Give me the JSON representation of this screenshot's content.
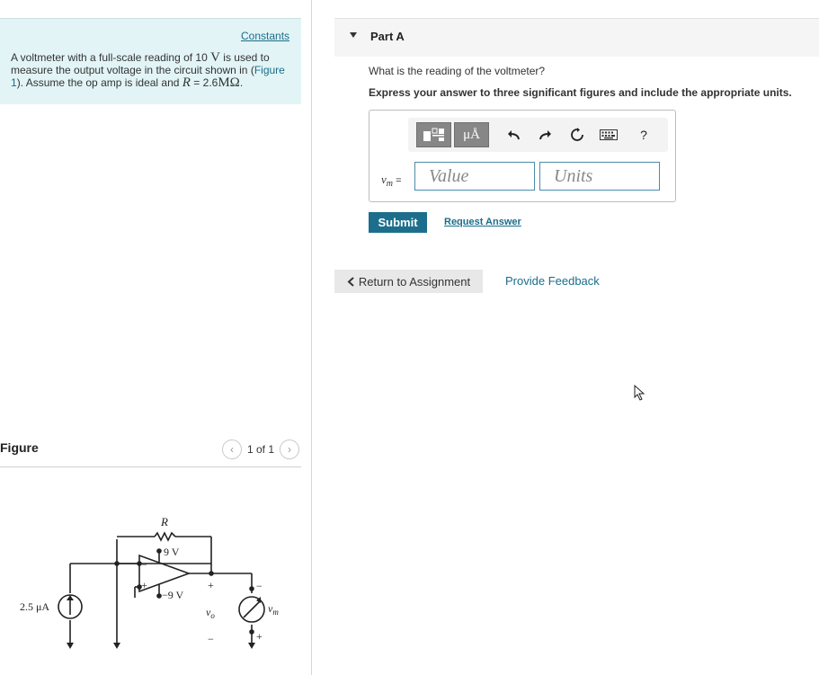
{
  "left": {
    "constants_link": "Constants",
    "problem": {
      "p1": "A voltmeter with a full-scale reading of 10 ",
      "p1_unit": "V",
      "p2": " is used to measure the output voltage in the circuit shown in (",
      "figure_link": "Figure 1",
      "p3": "). Assume the op amp is ideal and ",
      "r_sym": "R",
      "p4": " = 2.6",
      "r_unit": "MΩ",
      "p5": "."
    },
    "figure": {
      "title": "Figure",
      "pager": "1 of 1",
      "prev": "‹",
      "next": "›"
    },
    "circuit": {
      "r_label": "R",
      "vpos": "9 V",
      "vneg": "−9 V",
      "source_label": "2.5 μA",
      "vo": "v",
      "vo_sub": "o",
      "vm": "v",
      "vm_sub": "m",
      "plus": "+",
      "minus": "−"
    }
  },
  "part": {
    "label": "Part A",
    "question": "What is the reading of the voltmeter?",
    "instruction": "Express your answer to three significant figures and include the appropriate units.",
    "toolbar": {
      "units_btn": "μÅ",
      "help": "?"
    },
    "answer": {
      "var": "v",
      "var_sub": "m",
      "eq": " =",
      "value_placeholder": "Value",
      "units_placeholder": "Units"
    },
    "submit_label": "Submit",
    "request_label": "Request Answer"
  },
  "nav": {
    "return_label": "Return to Assignment",
    "feedback_label": "Provide Feedback"
  },
  "colors": {
    "accent": "#1d6e8d",
    "problem_bg": "#e2f4f6"
  }
}
